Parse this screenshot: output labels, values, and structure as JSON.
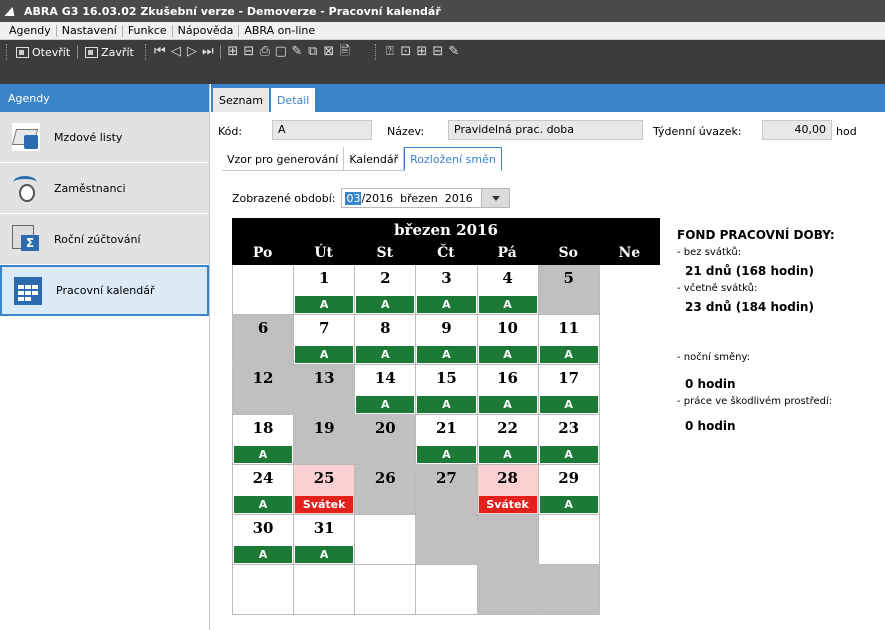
{
  "window": {
    "title": "ABRA G3 16.03.02 Zkušební verze - Demoverze - Pracovní kalendář"
  },
  "menu": [
    "Agendy",
    "Nastavení",
    "Funkce",
    "Nápověda",
    "ABRA on-line"
  ],
  "toolbar": {
    "open_label": "Otevřít",
    "close_label": "Zavřít",
    "nav_icons": [
      "first-icon",
      "prev-icon",
      "next-icon",
      "last-icon"
    ],
    "action_glyphs": [
      "⊞",
      "⊟",
      "⎙",
      "▢",
      "✎",
      "⧉",
      "⊠",
      "🖹"
    ],
    "extra_glyphs": [
      "⍰",
      "⊡",
      "⊞",
      "⊟",
      "✎"
    ]
  },
  "sidebar": {
    "header": "Agendy",
    "items": [
      {
        "label": "Mzdové listy",
        "icon": "payroll-icon"
      },
      {
        "label": "Zaměstnanci",
        "icon": "employees-icon"
      },
      {
        "label": "Roční zúčtování",
        "icon": "annual-settlement-icon"
      },
      {
        "label": "Pracovní kalendář",
        "icon": "calendar-icon",
        "active": true
      }
    ]
  },
  "tabs": [
    "Seznam",
    "Detail"
  ],
  "form": {
    "code_label": "Kód:",
    "code_value": "A",
    "name_label": "Název:",
    "name_value": "Pravidelná prac. doba",
    "weekly_label": "Týdenní úvazek:",
    "weekly_value": "40,00",
    "weekly_unit": "hod"
  },
  "subtabs": [
    "Vzor pro generování",
    "Kalendář",
    "Rozložení směn"
  ],
  "period": {
    "label": "Zobrazené období:",
    "month_highlight": "03",
    "rest": "/2016  březen  2016"
  },
  "calendar": {
    "title": "březen 2016",
    "weekdays": [
      "Po",
      "Út",
      "St",
      "Čt",
      "Pá",
      "So",
      "Ne"
    ],
    "cells": [
      {
        "day": "",
        "shift": "",
        "type": "empty"
      },
      {
        "day": "1",
        "shift": "A",
        "type": "work"
      },
      {
        "day": "2",
        "shift": "A",
        "type": "work"
      },
      {
        "day": "3",
        "shift": "A",
        "type": "work"
      },
      {
        "day": "4",
        "shift": "A",
        "type": "work"
      },
      {
        "day": "5",
        "shift": "",
        "type": "weekend"
      },
      {
        "day": "6",
        "shift": "",
        "type": "weekend"
      },
      {
        "day": "7",
        "shift": "A",
        "type": "work"
      },
      {
        "day": "8",
        "shift": "A",
        "type": "work"
      },
      {
        "day": "9",
        "shift": "A",
        "type": "work"
      },
      {
        "day": "10",
        "shift": "A",
        "type": "work"
      },
      {
        "day": "11",
        "shift": "A",
        "type": "work"
      },
      {
        "day": "12",
        "shift": "",
        "type": "weekend"
      },
      {
        "day": "13",
        "shift": "",
        "type": "weekend"
      },
      {
        "day": "14",
        "shift": "A",
        "type": "work"
      },
      {
        "day": "15",
        "shift": "A",
        "type": "work"
      },
      {
        "day": "16",
        "shift": "A",
        "type": "work"
      },
      {
        "day": "17",
        "shift": "A",
        "type": "work"
      },
      {
        "day": "18",
        "shift": "A",
        "type": "work"
      },
      {
        "day": "19",
        "shift": "",
        "type": "weekend"
      },
      {
        "day": "20",
        "shift": "",
        "type": "weekend"
      },
      {
        "day": "21",
        "shift": "A",
        "type": "work"
      },
      {
        "day": "22",
        "shift": "A",
        "type": "work"
      },
      {
        "day": "23",
        "shift": "A",
        "type": "work"
      },
      {
        "day": "24",
        "shift": "A",
        "type": "work"
      },
      {
        "day": "25",
        "shift": "Svátek",
        "type": "holiday"
      },
      {
        "day": "26",
        "shift": "",
        "type": "weekend"
      },
      {
        "day": "27",
        "shift": "",
        "type": "weekend"
      },
      {
        "day": "28",
        "shift": "Svátek",
        "type": "holiday"
      },
      {
        "day": "29",
        "shift": "A",
        "type": "work"
      },
      {
        "day": "30",
        "shift": "A",
        "type": "work"
      },
      {
        "day": "31",
        "shift": "A",
        "type": "work"
      },
      {
        "day": "",
        "shift": "",
        "type": "empty"
      },
      {
        "day": "",
        "shift": "",
        "type": "weekend"
      },
      {
        "day": "",
        "shift": "",
        "type": "weekend"
      },
      {
        "day": "",
        "shift": "",
        "type": "empty"
      },
      {
        "day": "",
        "shift": "",
        "type": "empty"
      },
      {
        "day": "",
        "shift": "",
        "type": "empty"
      },
      {
        "day": "",
        "shift": "",
        "type": "empty"
      },
      {
        "day": "",
        "shift": "",
        "type": "empty"
      },
      {
        "day": "",
        "shift": "",
        "type": "weekend"
      },
      {
        "day": "",
        "shift": "",
        "type": "weekend"
      }
    ]
  },
  "fund": {
    "title": "FOND PRACOVNÍ DOBY:",
    "no_holidays_label": "- bez svátků:",
    "no_holidays_value": "21 dnů (168 hodin)",
    "with_holidays_label": "- včetně svátků:",
    "with_holidays_value": "23 dnů (184 hodin)",
    "night_label": "- noční směny:",
    "night_value": "0 hodin",
    "harmful_label": "- práce ve škodlivém prostředí:",
    "harmful_value": "0 hodin"
  },
  "colors": {
    "accent": "#3a84c9",
    "work_shift": "#1c7a36",
    "holiday_shift": "#e3201b",
    "holiday_bg": "#fbd0d0",
    "weekend_bg": "#c0c0c0"
  }
}
